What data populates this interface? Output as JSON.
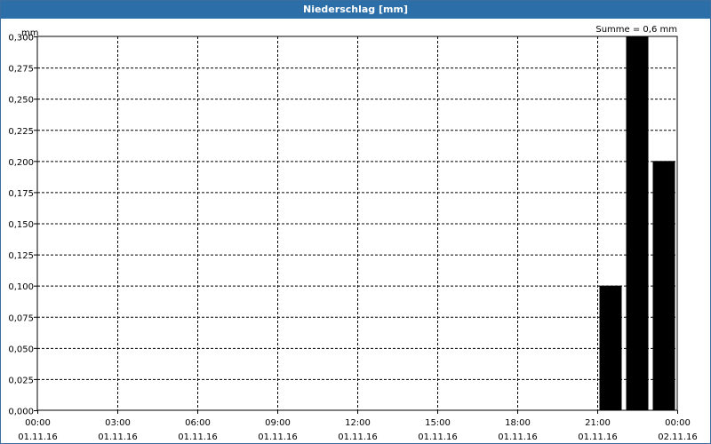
{
  "window": {
    "title": "Niederschlag [mm]"
  },
  "chart_data": {
    "type": "bar",
    "title": "Niederschlag [mm]",
    "ylabel": "mm",
    "summary": "Summe = 0,6 mm",
    "ylim": [
      0,
      0.3
    ],
    "yticks": [
      "0,000",
      "0,025",
      "0,050",
      "0,075",
      "0,100",
      "0,125",
      "0,150",
      "0,175",
      "0,200",
      "0,225",
      "0,250",
      "0,275",
      "0,300"
    ],
    "xlim": [
      "01.11.16 00:00",
      "02.11.16 00:00"
    ],
    "xticks": [
      {
        "time": "00:00",
        "date": "01.11.16"
      },
      {
        "time": "03:00",
        "date": "01.11.16"
      },
      {
        "time": "06:00",
        "date": "01.11.16"
      },
      {
        "time": "09:00",
        "date": "01.11.16"
      },
      {
        "time": "12:00",
        "date": "01.11.16"
      },
      {
        "time": "15:00",
        "date": "01.11.16"
      },
      {
        "time": "18:00",
        "date": "01.11.16"
      },
      {
        "time": "21:00",
        "date": "01.11.16"
      },
      {
        "time": "00:00",
        "date": "02.11.16"
      }
    ],
    "bars": [
      {
        "start": "01.11.16 21:00",
        "end": "01.11.16 22:00",
        "value": 0.1
      },
      {
        "start": "01.11.16 22:00",
        "end": "01.11.16 23:00",
        "value": 0.3
      },
      {
        "start": "01.11.16 23:00",
        "end": "02.11.16 00:00",
        "value": 0.2
      }
    ],
    "grid": true,
    "bar_color": "#000000"
  }
}
